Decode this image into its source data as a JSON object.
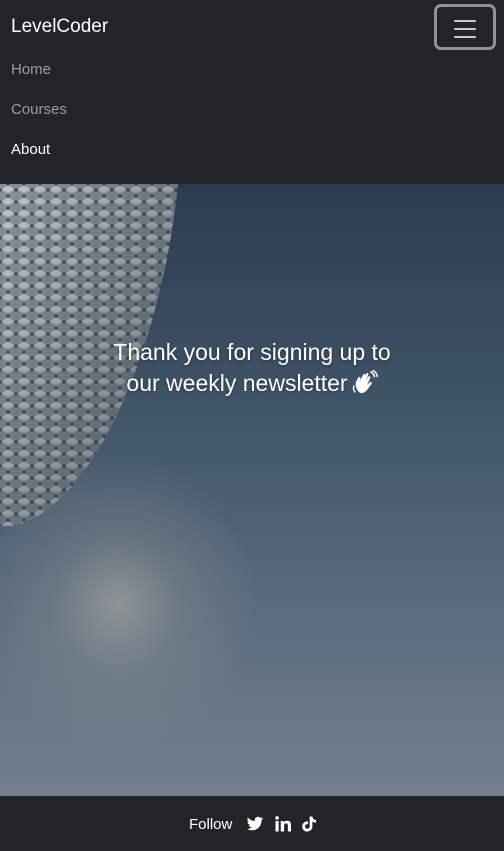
{
  "navbar": {
    "brand": "LevelCoder",
    "toggler_icon": "hamburger-menu-icon",
    "links": [
      {
        "label": "Home",
        "active": false
      },
      {
        "label": "Courses",
        "active": false
      },
      {
        "label": "About",
        "active": true
      }
    ]
  },
  "hero": {
    "message_line1": "Thank you for signing up to",
    "message_line2": "our weekly newsletter",
    "emoji_icon": "waving-hand-icon"
  },
  "footer": {
    "follow_label": "Follow",
    "social_icons": [
      "twitter-icon",
      "linkedin-icon",
      "tiktok-icon"
    ]
  },
  "colors": {
    "navbar_bg": "#212529",
    "text_light": "#ffffff",
    "nav_muted": "#9a9da0"
  }
}
